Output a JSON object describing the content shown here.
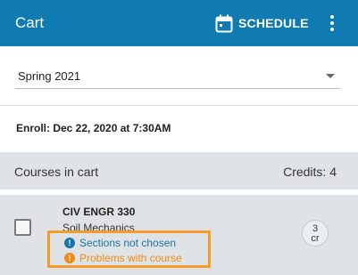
{
  "appbar": {
    "title": "Cart",
    "schedule_label": "SCHEDULE",
    "schedule_icon": "calendar-icon",
    "menu_icon": "more-vert-icon",
    "color": "#0f7bb0"
  },
  "term": {
    "selected": "Spring 2021"
  },
  "enroll": {
    "text": "Enroll: Dec 22, 2020 at 7:30AM"
  },
  "cart": {
    "header_label": "Courses in cart",
    "credits_label": "Credits: 4",
    "courses": [
      {
        "code": "CIV ENGR 330",
        "name": "Soil Mechanics",
        "credits_value": "3",
        "credits_unit": "cr",
        "checked": false,
        "issues": [
          {
            "text": "Sections not chosen",
            "icon": "info-icon",
            "color": "#1a73a8"
          },
          {
            "text": "Problems with course",
            "icon": "warning-icon",
            "color": "#f08a12"
          }
        ]
      }
    ]
  }
}
